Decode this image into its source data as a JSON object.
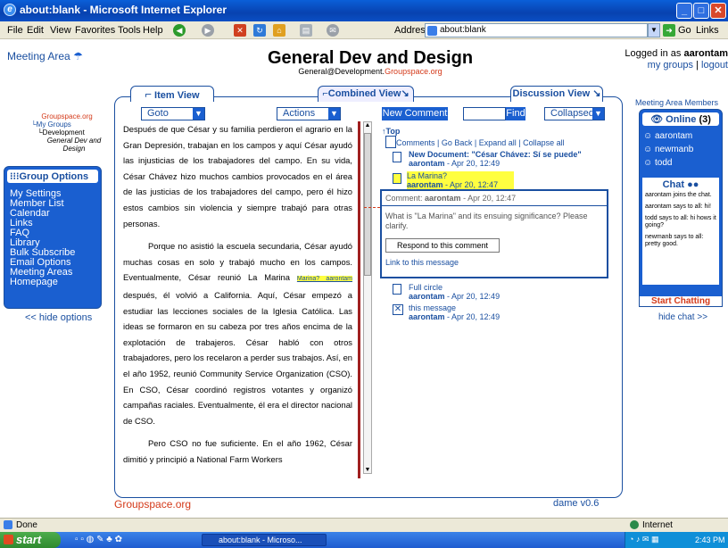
{
  "window": {
    "title": "about:blank - Microsoft Internet Explorer"
  },
  "menu": {
    "items": [
      "File",
      "Edit",
      "View",
      "Favorites",
      "Tools",
      "Help"
    ],
    "address_label": "Address",
    "address_value": "about:blank",
    "go": "Go",
    "links": "Links"
  },
  "header": {
    "meeting_area": "Meeting Area",
    "title": "General Dev and Design",
    "subtitle_prefix": "General@Development.",
    "subtitle_suffix": "Groupspace.org",
    "logged_in_prefix": "Logged in as ",
    "user": "aarontam",
    "my_groups": "my groups",
    "logout": "logout"
  },
  "sidebar": {
    "tree": [
      "Groupspace.org",
      "My Groups",
      "Development",
      "General Dev and Design"
    ],
    "options_title": "Group Options",
    "options": [
      "My Settings",
      "Member List",
      "Calendar",
      "Links",
      "FAQ",
      "Library",
      "Bulk Subscribe",
      "Email Options",
      "Meeting Areas",
      "Homepage"
    ],
    "hide_options": "<< hide options"
  },
  "tabs": {
    "item_view": "Item View",
    "combined_view": "Combined View",
    "discussion_view": "Discussion View"
  },
  "doc": {
    "goto": "Goto",
    "actions": "Actions",
    "p1": "Después de que César y su familia perdieron el agrario en la Gran Depresión, trabajan en los campos y aquí César ayudó las injusticias de los trabajadores del campo. En su vida, César Chávez hizo muchos cambios provocados en el área de las justicias de los trabajadores del campo, pero él hizo estos cambios sin violencia y siempre trabajó para otras personas.",
    "p2a": "Porque no asistió la escuela secundaria, César ayudó muchas cosas en solo y trabajó mucho en los campos. Eventualmente, César reunió La Marina",
    "p2_mark": "Marina? aarontam",
    "p2b": "después, él volvió a California. Aquí, César empezó a estudiar las lecciones sociales de la Iglesia Católica. Las ideas se formaron en su cabeza por tres años encima de la explotación de trabajeros. César habló con otros trabajadores, pero los recelaron a perder sus trabajos. Así, en el año 1952, reunió Community Service Organization (CSO). En CSO, César coordinó registros votantes y organizó campañas raciales. Eventualmente, él era el director nacional de CSO.",
    "p3": "Pero CSO no fue suficiente. En el año 1962, César dimitió y principió a National Farm Workers"
  },
  "comments": {
    "new_comment": "New Comment",
    "find": "Find",
    "collapsed": "Collapsed",
    "top": "Top",
    "toolbar": "Comments | Go Back | Expand all | Collapse all",
    "items": [
      {
        "title": "New Document: \"César Chávez: Sí se puede\"",
        "author": "aarontam",
        "date": "Apr 20, 12:49"
      },
      {
        "title": "La Marina?",
        "author": "aarontam",
        "date": "Apr 20, 12:47"
      },
      {
        "title": "Full circle",
        "author": "aarontam",
        "date": "Apr 20, 12:49"
      },
      {
        "title": "this message",
        "author": "aarontam",
        "date": "Apr 20, 12:49"
      }
    ],
    "detail": {
      "label": "Comment:",
      "author": "aarontam",
      "date": "- Apr 20, 12:47",
      "text": "What is \"La Marina\" and its ensuing significance? Please clarify.",
      "respond": "Respond to this comment",
      "link": "Link to this message"
    }
  },
  "right": {
    "members_title": "Meeting Area Members",
    "online_label": "Online",
    "online_count": "(3)",
    "members": [
      "aarontam",
      "newmanb",
      "todd"
    ],
    "chat_title": "Chat",
    "chat": [
      "aarontam joins the chat.",
      "aarontam says to all: hi!",
      "todd says to all: hi hows it going?",
      "newmanb says to all: pretty good."
    ],
    "start_chatting": "Start Chatting",
    "hide_chat": "hide chat >>"
  },
  "footer": {
    "left": "Groupspace.org",
    "right": "dame v0.6"
  },
  "status": {
    "done": "Done",
    "zone": "Internet"
  },
  "taskbar": {
    "start": "start",
    "task": "about:blank - Microso...",
    "clock": "2:43 PM"
  },
  "colors": {
    "accent": "#1a4fa0",
    "red": "#d43a1a",
    "highlight": "#ffff40"
  }
}
